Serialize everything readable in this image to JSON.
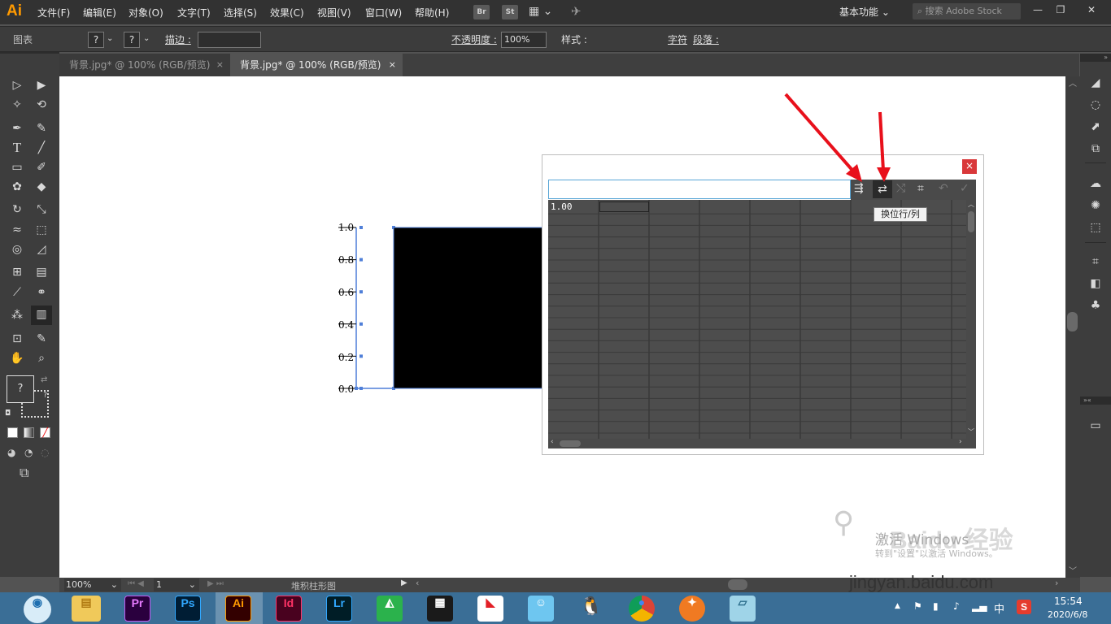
{
  "app": {
    "logo": "Ai"
  },
  "menu": [
    "文件(F)",
    "编辑(E)",
    "对象(O)",
    "文字(T)",
    "选择(S)",
    "效果(C)",
    "视图(V)",
    "窗口(W)",
    "帮助(H)"
  ],
  "menu_buttons": {
    "br": "Br",
    "st": "St"
  },
  "workspace": "基本功能",
  "search": {
    "placeholder": "搜索 Adobe Stock"
  },
  "window_controls": {
    "minimize": "—",
    "restore": "❐",
    "close": "✕"
  },
  "control_bar": {
    "selection_label": "图表",
    "fill": "?",
    "stroke": "?",
    "stroke_label": "描边 :",
    "stroke_style": "基本",
    "opacity_label": "不透明度 :",
    "opacity_value": "100%",
    "style_label": "样式 :",
    "char_label": "字符",
    "para_label": "段落 :"
  },
  "tabs": [
    {
      "label": "背景.jpg* @ 100% (RGB/预览)",
      "active": false
    },
    {
      "label": "背景.jpg* @ 100% (RGB/预览)",
      "active": true
    }
  ],
  "tab_close": "×",
  "tools": {
    "fill_stroke": "?",
    "small_q": "?"
  },
  "chart_data": {
    "type": "bar",
    "categories": [
      ""
    ],
    "values": [
      1.0
    ],
    "ylim": [
      0,
      1.0
    ],
    "yticks": [
      "1.0",
      "0.8",
      "0.6",
      "0.4",
      "0.2",
      "0.0"
    ],
    "bar_color": "#000000"
  },
  "data_window": {
    "close": "×",
    "input_value": "",
    "cell_a1": "1.00",
    "tooltip": "换位行/列"
  },
  "statusbar": {
    "zoom": "100%",
    "page": "1",
    "tool_name": "堆积柱形图"
  },
  "watermark": {
    "activate": "激活 Windows",
    "activate_sub": "转到\"设置\"以激活 Windows。",
    "baidu_text": "Baidu 经验",
    "site": "jingyan.baidu.com"
  },
  "taskbar": {
    "apps": [
      "Pr",
      "Ps",
      "Ai",
      "Id",
      "Lr"
    ],
    "ime": "中",
    "time": "15:54",
    "date": "2020/6/8"
  }
}
